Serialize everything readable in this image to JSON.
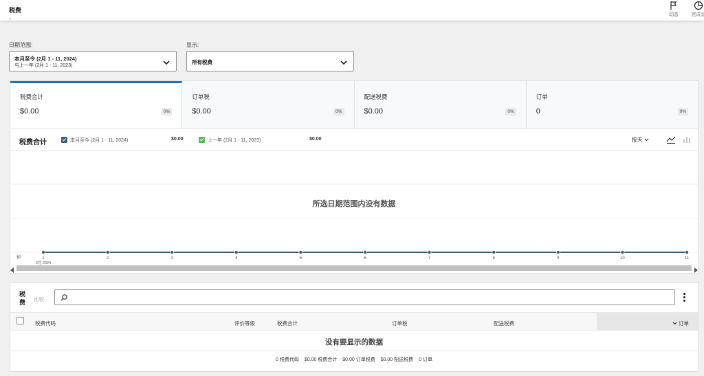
{
  "header": {
    "title": "税费",
    "activity_label": "动态",
    "setup_label": "完成设"
  },
  "filters": {
    "date_range_label": "日期范围:",
    "date_range_primary": "本月至今 (2月 1 - 11, 2024)",
    "date_range_compare": "与上一年 (2月 1 - 11, 2023)",
    "show_label": "显示:",
    "show_value": "所有税费"
  },
  "summary_cards": [
    {
      "title": "税费合计",
      "value": "$0.00",
      "delta": "0%"
    },
    {
      "title": "订单税",
      "value": "$0.00",
      "delta": "0%"
    },
    {
      "title": "配送税费",
      "value": "$0.00",
      "delta": "0%"
    },
    {
      "title": "订单",
      "value": "0",
      "delta": "0%"
    }
  ],
  "chart": {
    "title": "税费合计",
    "legend": [
      {
        "label": "本月至今 (2月 1 - 11, 2024)",
        "value": "$0.00",
        "color": "#3b5d7c"
      },
      {
        "label": "上一年 (2月 1 - 11, 2023)",
        "value": "$0.00",
        "color": "#5cb85c"
      }
    ],
    "interval": "按天",
    "no_data": "所选日期范围内没有数据"
  },
  "chart_data": {
    "type": "line",
    "x": [
      "1",
      "2",
      "3",
      "4",
      "5",
      "6",
      "7",
      "8",
      "9",
      "10",
      "11"
    ],
    "x_sublabel": "2月 2024",
    "series": [
      {
        "name": "本月至今 (2月 1 - 11, 2024)",
        "values": [
          0,
          0,
          0,
          0,
          0,
          0,
          0,
          0,
          0,
          0,
          0
        ]
      },
      {
        "name": "上一年 (2月 1 - 11, 2023)",
        "values": [
          0,
          0,
          0,
          0,
          0,
          0,
          0,
          0,
          0,
          0,
          0
        ]
      }
    ],
    "y_tick": "$0",
    "colors": {
      "line": "#3b5d7c"
    },
    "grid": true
  },
  "table": {
    "title": "税费",
    "compare": "比较",
    "search_placeholder": "",
    "columns": [
      "税费代码",
      "评价等级",
      "税费合计",
      "订单税",
      "配送税费",
      "订单"
    ],
    "empty": "没有要显示的数据",
    "summary": [
      "0 税费代码",
      "$0.00 税费合计",
      "$0.00 订单税费",
      "$0.00 配送税费",
      "0 订单"
    ]
  }
}
